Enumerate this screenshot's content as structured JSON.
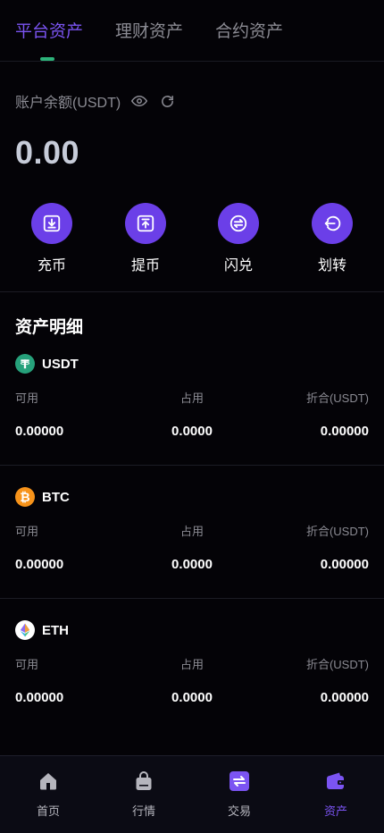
{
  "tabs": [
    {
      "label": "平台资产",
      "active": true
    },
    {
      "label": "理财资产",
      "active": false
    },
    {
      "label": "合约资产",
      "active": false
    }
  ],
  "balance": {
    "label": "账户余额(USDT)",
    "value": "0.00",
    "icons": [
      "eye-icon",
      "refresh-icon"
    ]
  },
  "actions": [
    {
      "label": "充币",
      "icon": "deposit-icon"
    },
    {
      "label": "提币",
      "icon": "withdraw-icon"
    },
    {
      "label": "闪兑",
      "icon": "swap-icon"
    },
    {
      "label": "划转",
      "icon": "transfer-icon"
    }
  ],
  "section": {
    "title": "资产明细"
  },
  "columns": {
    "available": "可用",
    "occupied": "占用",
    "converted": "折合(USDT)"
  },
  "assets": [
    {
      "symbol": "USDT",
      "coin_color": "#26a17b",
      "glyph": "₮",
      "available": "0.00000",
      "occupied": "0.0000",
      "converted": "0.00000"
    },
    {
      "symbol": "BTC",
      "coin_color": "#f7931a",
      "glyph": "₿",
      "available": "0.00000",
      "occupied": "0.0000",
      "converted": "0.00000"
    },
    {
      "symbol": "ETH",
      "coin_color": "#ffffff",
      "glyph": "◆",
      "available": "0.00000",
      "occupied": "0.0000",
      "converted": "0.00000"
    }
  ],
  "nav": [
    {
      "label": "首页",
      "icon": "home-icon",
      "active": false
    },
    {
      "label": "行情",
      "icon": "market-icon",
      "active": false
    },
    {
      "label": "交易",
      "icon": "trade-icon",
      "active": false
    },
    {
      "label": "资产",
      "icon": "wallet-icon",
      "active": true
    }
  ],
  "colors": {
    "accent": "#7b54f2",
    "action_bg": "#6b3fe8",
    "indicator": "#2db37a",
    "background": "#040307"
  }
}
